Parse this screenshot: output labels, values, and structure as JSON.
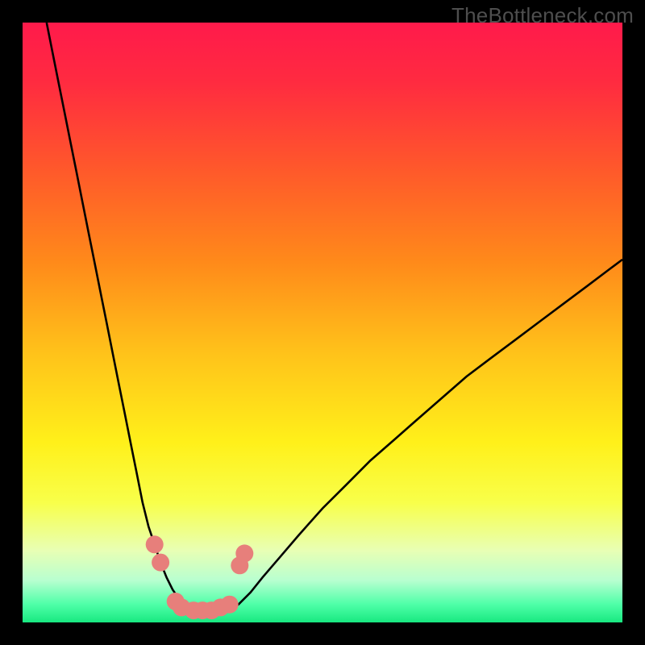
{
  "watermark": "TheBottleneck.com",
  "chart_data": {
    "type": "line",
    "title": "",
    "xlabel": "",
    "ylabel": "",
    "xlim": [
      0,
      100
    ],
    "ylim": [
      0,
      100
    ],
    "grid": false,
    "legend": false,
    "gradient_stops": [
      {
        "offset": 0.0,
        "color": "#ff1a4b"
      },
      {
        "offset": 0.1,
        "color": "#ff2b40"
      },
      {
        "offset": 0.25,
        "color": "#ff5a2a"
      },
      {
        "offset": 0.4,
        "color": "#ff8a1a"
      },
      {
        "offset": 0.55,
        "color": "#ffc21a"
      },
      {
        "offset": 0.7,
        "color": "#fff01a"
      },
      {
        "offset": 0.8,
        "color": "#f8ff4a"
      },
      {
        "offset": 0.88,
        "color": "#e8ffb4"
      },
      {
        "offset": 0.93,
        "color": "#b8ffd0"
      },
      {
        "offset": 0.97,
        "color": "#4effa8"
      },
      {
        "offset": 1.0,
        "color": "#18e880"
      }
    ],
    "series": [
      {
        "name": "bottleneck-curve",
        "stroke": "#000000",
        "stroke_width": 2.6,
        "x": [
          4,
          5,
          6,
          7,
          8,
          9,
          10,
          11,
          12,
          13,
          14,
          15,
          16,
          17,
          18,
          19,
          20,
          21,
          22,
          23,
          24,
          25,
          26,
          27,
          28,
          29,
          30,
          31,
          32,
          33,
          34,
          36,
          38,
          40,
          43,
          46,
          50,
          54,
          58,
          62,
          66,
          70,
          74,
          78,
          82,
          86,
          90,
          94,
          98,
          100
        ],
        "y": [
          100,
          95,
          90,
          85,
          80,
          75,
          70,
          65,
          60,
          55,
          50,
          45,
          40,
          35,
          30,
          25,
          20,
          16,
          13,
          10,
          7.5,
          5.5,
          4,
          3,
          2.2,
          1.7,
          1.4,
          1.3,
          1.3,
          1.5,
          2,
          3,
          5,
          7.5,
          11,
          14.5,
          19,
          23,
          27,
          30.5,
          34,
          37.5,
          41,
          44,
          47,
          50,
          53,
          56,
          59,
          60.5
        ]
      }
    ],
    "markers": {
      "name": "highlight-points",
      "fill": "#e77f7b",
      "radius": 11,
      "points": [
        {
          "x": 22.0,
          "y": 13.0
        },
        {
          "x": 23.0,
          "y": 10.0
        },
        {
          "x": 25.5,
          "y": 3.5
        },
        {
          "x": 26.5,
          "y": 2.5
        },
        {
          "x": 28.5,
          "y": 2.0
        },
        {
          "x": 30.0,
          "y": 2.0
        },
        {
          "x": 31.5,
          "y": 2.0
        },
        {
          "x": 33.0,
          "y": 2.5
        },
        {
          "x": 34.5,
          "y": 3.0
        },
        {
          "x": 36.2,
          "y": 9.5
        },
        {
          "x": 37.0,
          "y": 11.5
        }
      ]
    }
  }
}
